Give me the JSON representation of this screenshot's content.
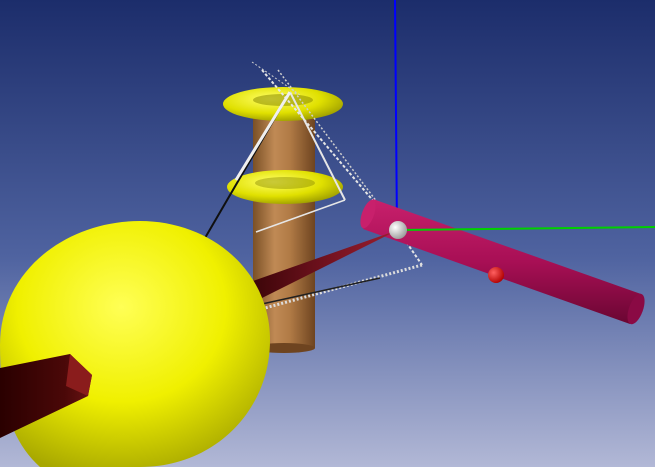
{
  "viewport": {
    "background_top": "#1c2d6b",
    "background_bottom": "#b2b8d6"
  },
  "axes": {
    "z_color": "#0000ff",
    "y_color": "#00d000"
  },
  "objects": {
    "yellow_sphere_color": "#f2f200",
    "dark_rod_color": "#5a0a0a",
    "column_color": "#b07a45",
    "torus_color": "#e6e600",
    "magenta_rod_color": "#b0105a",
    "red_ball_color": "#e01010",
    "white_ball_color": "#e8e8e8",
    "cone_color": "#6a0f1a"
  }
}
